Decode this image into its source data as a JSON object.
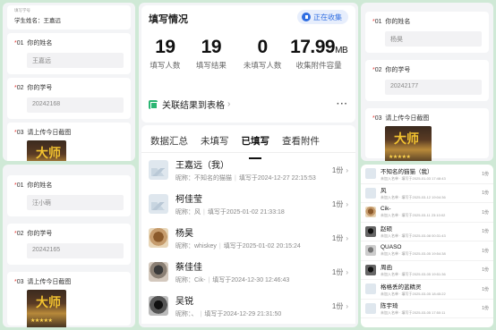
{
  "left_top": {
    "note": "填写学号",
    "header": "学生姓名：王嘉远",
    "questions": [
      {
        "num": "01",
        "title": "你的姓名",
        "value": "王嘉远"
      },
      {
        "num": "02",
        "title": "你的学号",
        "value": "20242168"
      },
      {
        "num": "03",
        "title": "请上传今日截图"
      }
    ]
  },
  "left_bottom": {
    "questions": [
      {
        "num": "01",
        "title": "你的姓名",
        "value": "汪小萌"
      },
      {
        "num": "02",
        "title": "你的学号",
        "value": "20242165"
      },
      {
        "num": "03",
        "title": "请上传今日截图"
      }
    ]
  },
  "right_top": {
    "questions": [
      {
        "num": "01",
        "title": "你的姓名",
        "value": "杨昊"
      },
      {
        "num": "02",
        "title": "你的学号",
        "value": "20242177"
      },
      {
        "num": "03",
        "title": "请上传今日截图"
      }
    ]
  },
  "center": {
    "title": "填写情况",
    "collect_label": "正在收集",
    "stats": [
      {
        "value": "19",
        "unit": "",
        "label": "填写人数"
      },
      {
        "value": "19",
        "unit": "",
        "label": "填写结果"
      },
      {
        "value": "0",
        "unit": "",
        "label": "未填写人数"
      },
      {
        "value": "17.99",
        "unit": "MB",
        "label": "收集附件容量"
      }
    ],
    "link_label": "关联结果到表格",
    "more": "···",
    "tabs": [
      "数据汇总",
      "未填写",
      "已填写",
      "查看附件"
    ],
    "active_tab": 2,
    "rows": [
      {
        "name": "王嘉远（我）",
        "nick_label": "昵称：",
        "nick": "不知名的猫猫",
        "time": "填写于2024-12-27 22:15:53",
        "count": "1份",
        "avatar": "placeholder"
      },
      {
        "name": "柯佳莹",
        "nick_label": "昵称：",
        "nick": "风",
        "time": "填写于2025-01-02 21:33:18",
        "count": "1份",
        "avatar": "placeholder"
      },
      {
        "name": "杨昊",
        "nick_label": "昵称：",
        "nick": "whiskey",
        "time": "填写于2025-01-02 20:15:24",
        "count": "1份",
        "avatar": "dog"
      },
      {
        "name": "蔡佳佳",
        "nick_label": "昵称：",
        "nick": "Cik-",
        "time": "填写于2024-12-30 12:46:43",
        "count": "1份",
        "avatar": "person"
      },
      {
        "name": "吴锐",
        "nick_label": "昵称：",
        "nick": "、",
        "time": "填写于2024-12-29 21:31:50",
        "count": "1份",
        "avatar": "dark"
      }
    ]
  },
  "right_bottom": {
    "rows": [
      {
        "name": "不知名的猫猫（我）",
        "sub": "未加入名单 · 填写于2025-01-03 17:48:43",
        "count": "1份",
        "avatar": "placeholder"
      },
      {
        "name": "风",
        "sub": "未加入名单 · 填写于2025-03-12 19:04:36",
        "count": "1份",
        "avatar": "placeholder"
      },
      {
        "name": "Cik-",
        "sub": "未加入名单 · 填写于2025-03-11 23:10:02",
        "count": "1份",
        "avatar": "dog"
      },
      {
        "name": "赵硕",
        "sub": "未加入名单 · 填写于2025-03-08 00:31:43",
        "count": "1份",
        "avatar": "dark"
      },
      {
        "name": "QUASO",
        "sub": "未加入名单 · 填写于2025-03-05 19:54:38",
        "count": "1份",
        "avatar": "cat"
      },
      {
        "name": "周函",
        "sub": "未加入名单 · 填写于2025-03-05 19:51:36",
        "count": "1份",
        "avatar": "dark"
      },
      {
        "name": "格格丢的蓝精灵",
        "sub": "未加入名单 · 填写于2025-03-05 18:45:22",
        "count": "1份",
        "avatar": "placeholder"
      },
      {
        "name": "陈宇琦",
        "sub": "未加入名单 · 填写于2025-03-05 17:50:11",
        "count": "1份",
        "avatar": "placeholder"
      }
    ]
  },
  "screenshot_glyph": "大师",
  "screenshot_stars": "★★★★★",
  "colors": {
    "accent": "#2f6de1",
    "required": "#e53935",
    "sheet": "#2bb673",
    "background": "#cfe9d6"
  }
}
